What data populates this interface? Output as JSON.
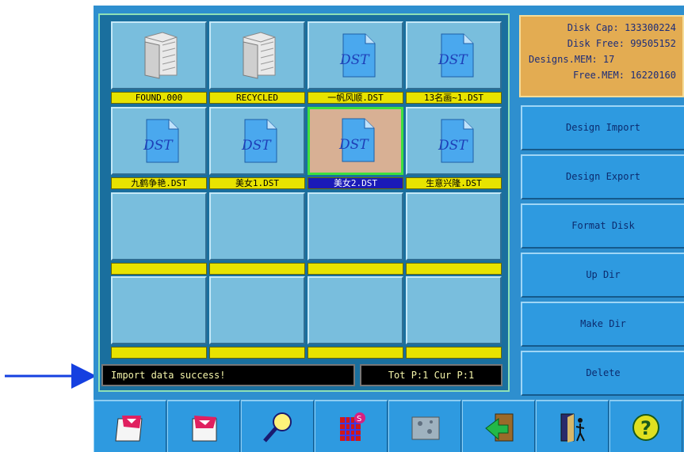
{
  "files": [
    {
      "label": "FOUND.000",
      "icon": "folder-icon",
      "selected": false
    },
    {
      "label": "RECYCLED",
      "icon": "folder-icon",
      "selected": false
    },
    {
      "label": "一帆风顺.DST",
      "icon": "dst-file-icon",
      "selected": false
    },
    {
      "label": "13名画~1.DST",
      "icon": "dst-file-icon",
      "selected": false
    },
    {
      "label": "九鹤争艳.DST",
      "icon": "dst-file-icon",
      "selected": false
    },
    {
      "label": "美女1.DST",
      "icon": "dst-file-icon",
      "selected": false
    },
    {
      "label": "美女2.DST",
      "icon": "dst-file-icon",
      "selected": true
    },
    {
      "label": "生意兴隆.DST",
      "icon": "dst-file-icon",
      "selected": false
    }
  ],
  "status": {
    "message": "Import data success!",
    "pages": "Tot P:1 Cur P:1"
  },
  "disk_info": {
    "cap": "Disk Cap: 133300224",
    "free": "Disk Free: 99505152",
    "designs_mem": "Designs.MEM: 17",
    "free_mem": "Free.MEM: 16220160"
  },
  "side_buttons": {
    "import": "Design Import",
    "export": "Design Export",
    "format": "Format Disk",
    "up": "Up Dir",
    "make": "Make Dir",
    "delete": "Delete"
  },
  "toolbar_icons": [
    "page-back-icon",
    "page-next-icon",
    "search-icon",
    "stitch-grid-icon",
    "pattern-preview-icon",
    "return-icon",
    "exit-door-icon",
    "help-icon"
  ],
  "dst_icon_text": "DST",
  "colors": {
    "label_yellow": "#e8e300",
    "selected_label": "#1a1ab8",
    "selected_thumb": "#d8b094",
    "panel_blue": "#2e8fcf",
    "info_panel": "#e3ac52"
  }
}
